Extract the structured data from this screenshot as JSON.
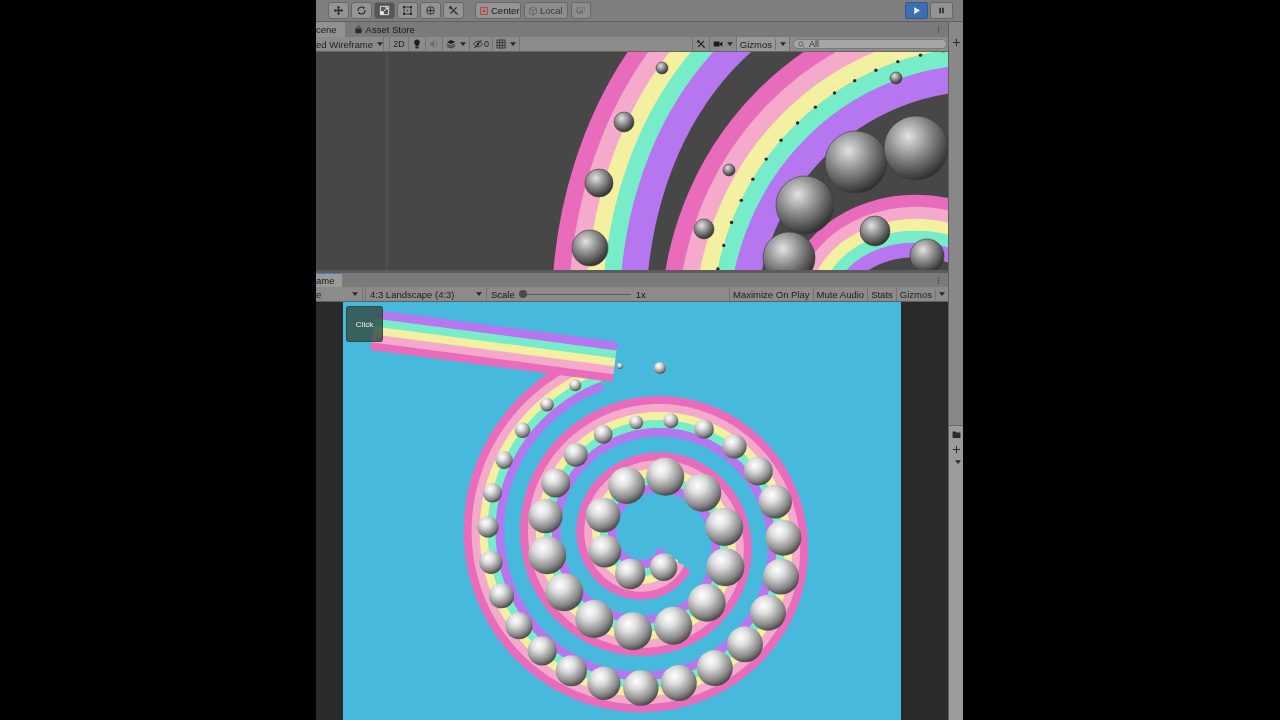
{
  "main_toolbar": {
    "tools": [
      {
        "selected": false
      },
      {
        "selected": false
      },
      {
        "selected": true
      },
      {
        "selected": false
      },
      {
        "selected": false
      },
      {
        "selected": false
      }
    ],
    "pivot_mode": "Center",
    "pivot_rotation": {
      "label": "Local",
      "disabled": true
    },
    "snap": {
      "disabled": true
    },
    "play": {
      "on": true
    },
    "pause": {
      "on": false
    }
  },
  "scene_panel": {
    "tabs": [
      {
        "label": "cene",
        "kind": "scene",
        "selected": true
      },
      {
        "label": "Asset Store",
        "kind": "asset_store",
        "selected": false
      }
    ],
    "toolbar": {
      "draw_mode": "ed Wireframe",
      "mode_2d": {
        "label": "2D",
        "on": false
      },
      "lighting": {
        "on": true
      },
      "audio": {
        "on": false
      },
      "hidden_count": "0",
      "gizmos": "Gizmos",
      "search": {
        "placeholder": "All"
      }
    }
  },
  "game_panel": {
    "tabs": [
      {
        "label": "ame",
        "selected": true
      }
    ],
    "toolbar": {
      "display": "e",
      "aspect": "4:3 Landscape (4:3)",
      "scale": {
        "label": "Scale",
        "level": 0,
        "reading": "1x"
      },
      "toggles": [
        {
          "label": "Maximize On Play",
          "on": false
        },
        {
          "label": "Mute Audio",
          "on": false
        },
        {
          "label": "Stats",
          "on": false
        }
      ],
      "gizmos": "Gizmos"
    },
    "game_button": {
      "label": "Click"
    }
  }
}
